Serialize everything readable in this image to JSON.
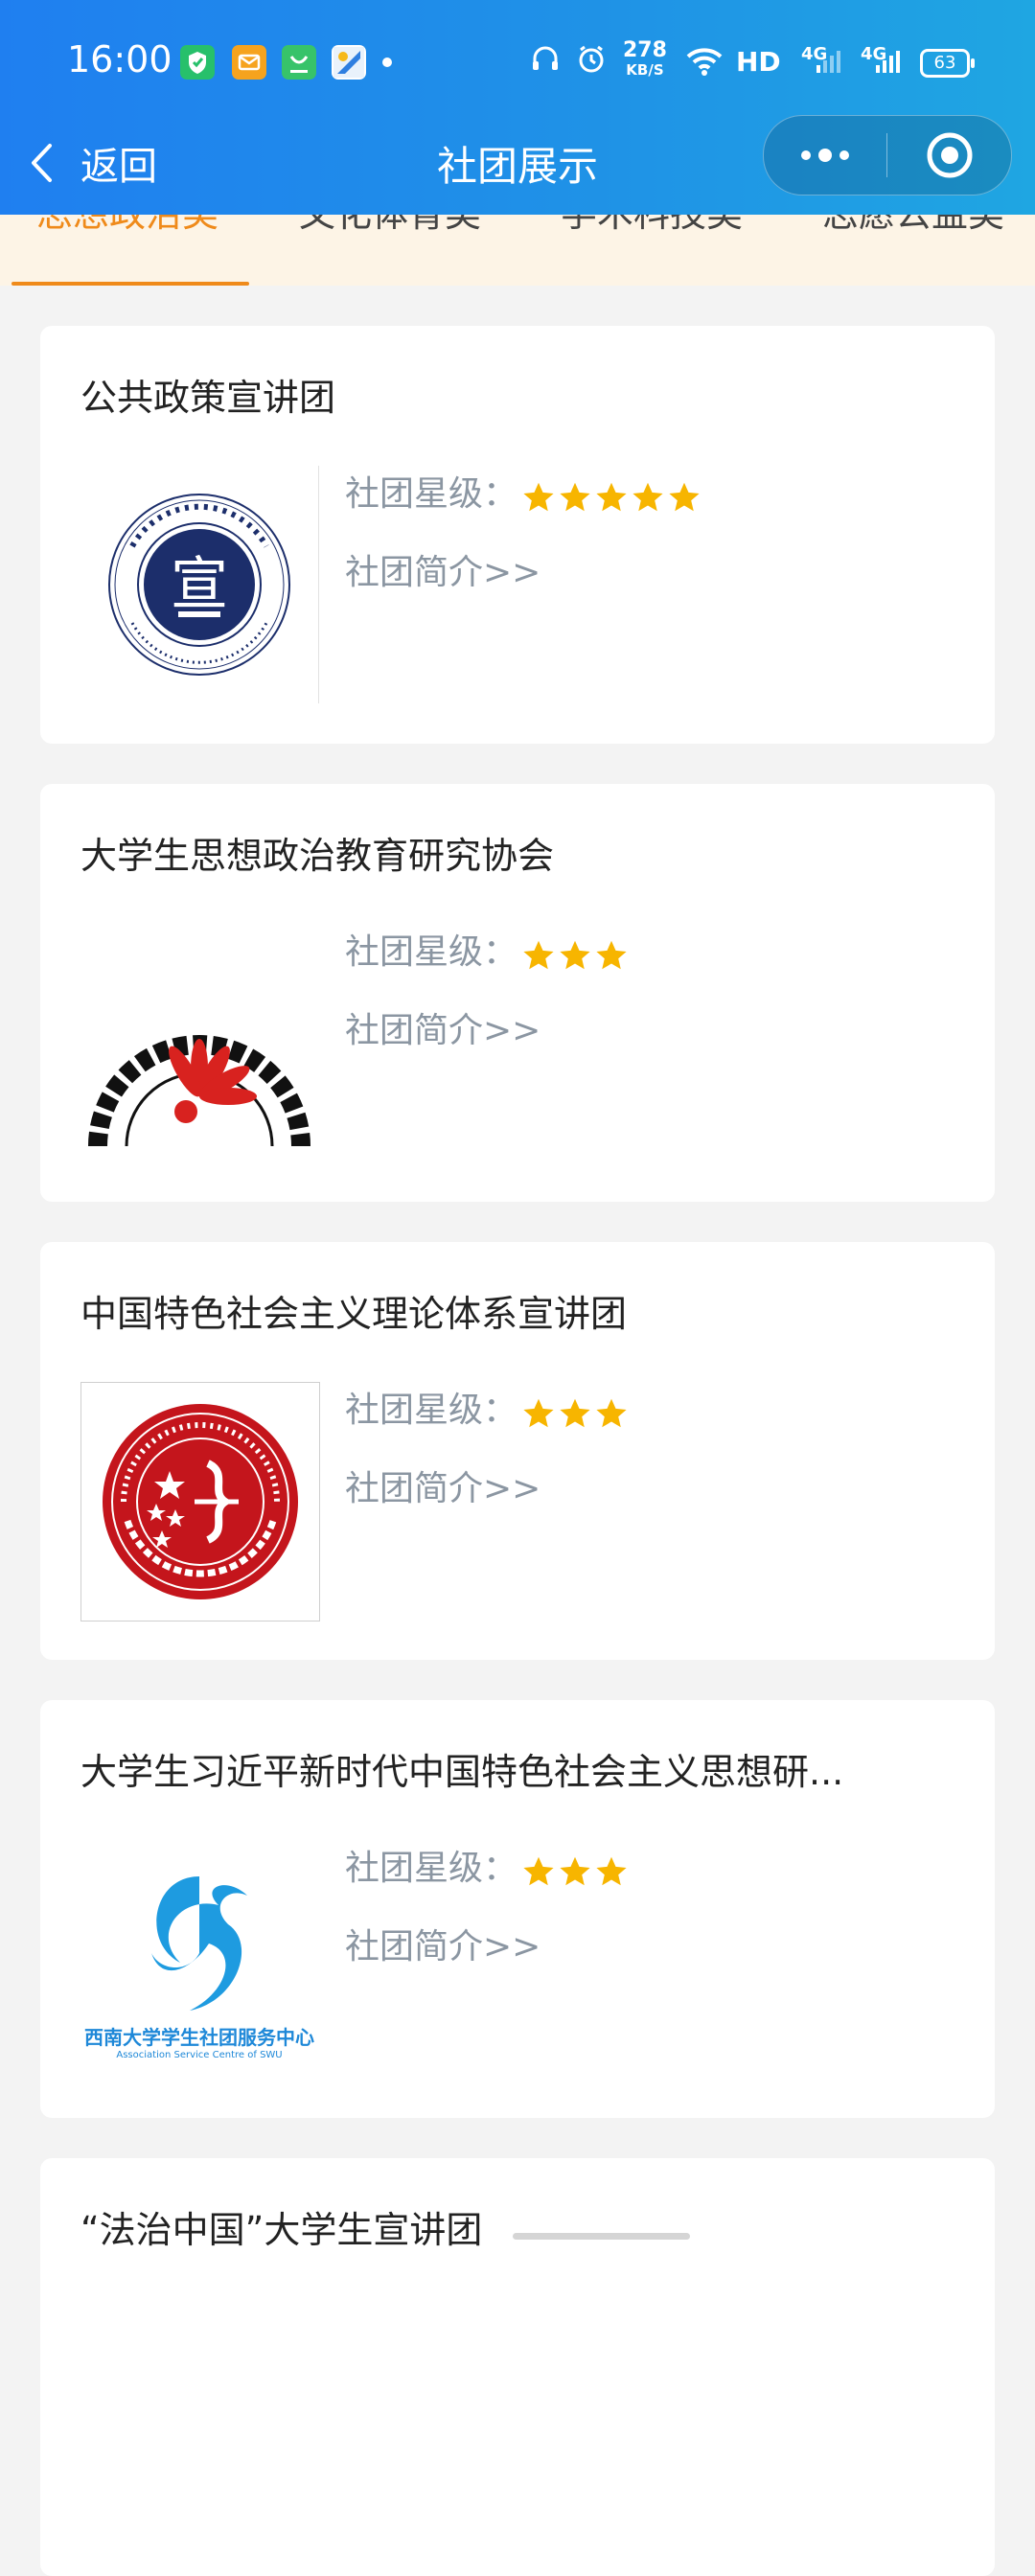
{
  "status_bar": {
    "time": "16:00",
    "net_speed_value": "278",
    "net_speed_unit": "KB/S",
    "hd_label": "HD",
    "signal_1": "4G",
    "signal_2": "4G",
    "battery": "63",
    "notification_icons": [
      "shield-app-icon",
      "mail-app-icon",
      "chat-app-icon",
      "map-app-icon"
    ]
  },
  "navbar": {
    "back_label": "返回",
    "title": "社团展示"
  },
  "tabs": [
    {
      "label": "思想政治类",
      "active": true
    },
    {
      "label": "文化体育类",
      "active": false
    },
    {
      "label": "学术科技类",
      "active": false
    },
    {
      "label": "志愿公益类",
      "active": false
    }
  ],
  "clubs": [
    {
      "name": "公共政策宣讲团",
      "rating_label": "社团星级：",
      "stars": 5,
      "intro_link": "社团简介>>",
      "logo": "public-policy-seal-logo"
    },
    {
      "name": "大学生思想政治教育研究协会",
      "rating_label": "社团星级：",
      "stars": 3,
      "intro_link": "社团简介>>",
      "logo": "ideological-education-logo"
    },
    {
      "name": "中国特色社会主义理论体系宣讲团",
      "rating_label": "社团星级：",
      "stars": 3,
      "intro_link": "社团简介>>",
      "logo": "southwest-university-red-seal-logo"
    },
    {
      "name": "大学生习近平新时代中国特色社会主义思想研...",
      "rating_label": "社团星级：",
      "stars": 3,
      "intro_link": "社团简介>>",
      "logo": "association-service-centre-bird-logo",
      "logo_text": "西南大学学生社团服务中心",
      "logo_subtext": "Association Service Centre of SWU"
    },
    {
      "name": "“法治中国”大学生宣讲团"
    }
  ],
  "colors": {
    "header_start": "#1f7ff0",
    "header_end": "#1fa6e2",
    "tab_active": "#ef8a1a",
    "tab_bg": "#fdf4e6",
    "star": "#f7b500",
    "meta_text": "#8b96a2"
  }
}
